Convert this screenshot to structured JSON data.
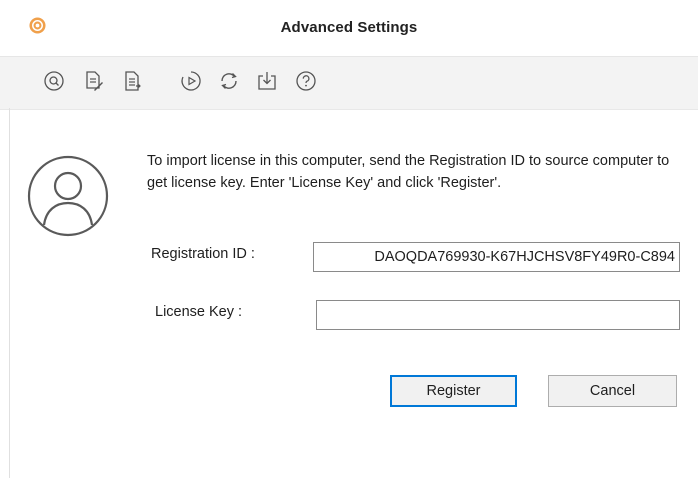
{
  "window": {
    "title": "Advanced Settings"
  },
  "toolbar": {
    "icons": [
      "search-circle-icon",
      "document-edit-icon",
      "document-export-icon",
      "play-circle-icon",
      "refresh-icon",
      "download-tray-icon",
      "help-icon"
    ]
  },
  "content": {
    "info_text": "To import license in this computer, send the Registration ID to source computer to get license key. Enter 'License Key' and click 'Register'.",
    "registration_label": "Registration ID :",
    "registration_value": "DAOQDA769930-K67HJCHSV8FY49R0-C894",
    "license_label": "License Key :",
    "license_value": "",
    "license_placeholder": ""
  },
  "buttons": {
    "register": "Register",
    "cancel": "Cancel"
  },
  "colors": {
    "accent": "#0078d7",
    "app_icon": "#f0a04b",
    "toolbar_bg": "#f3f3f3"
  }
}
